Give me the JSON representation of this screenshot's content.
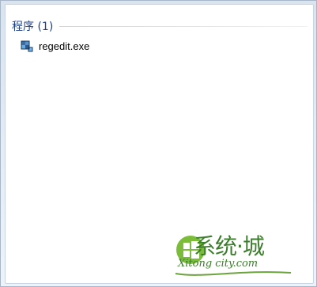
{
  "results": {
    "group_title": "程序 (1)",
    "items": [
      {
        "label": "regedit.exe",
        "icon": "regedit-icon"
      }
    ]
  },
  "watermark": {
    "cn_text": "系统·城",
    "en_text": "Xitong city.com"
  }
}
